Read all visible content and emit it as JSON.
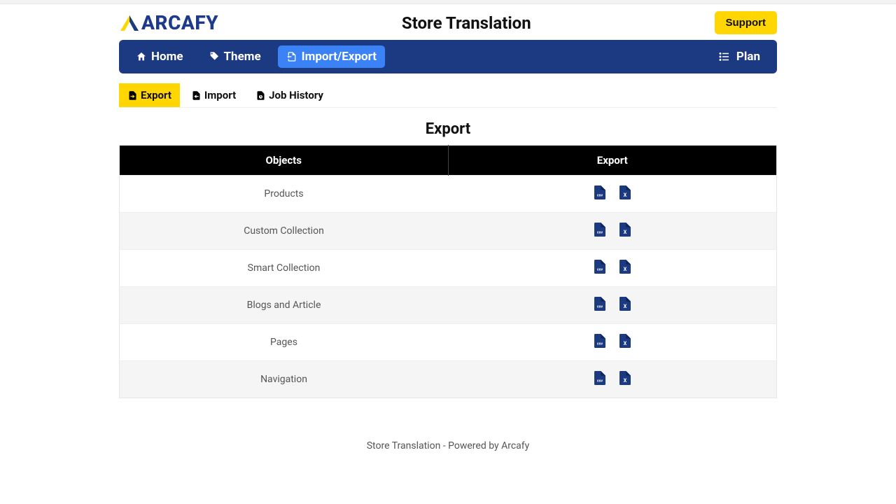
{
  "brand": "ARCAFY",
  "app_title": "Store Translation",
  "support_label": "Support",
  "nav": {
    "home": "Home",
    "theme": "Theme",
    "import_export": "Import/Export",
    "plan": "Plan"
  },
  "tabs": {
    "export": "Export",
    "import": "Import",
    "job_history": "Job History"
  },
  "section_title": "Export",
  "table": {
    "col_objects": "Objects",
    "col_export": "Export",
    "rows": [
      {
        "name": "Products"
      },
      {
        "name": "Custom Collection"
      },
      {
        "name": "Smart Collection"
      },
      {
        "name": "Blogs and Article"
      },
      {
        "name": "Pages"
      },
      {
        "name": "Navigation"
      }
    ]
  },
  "footer": "Store Translation - Powered by Arcafy"
}
